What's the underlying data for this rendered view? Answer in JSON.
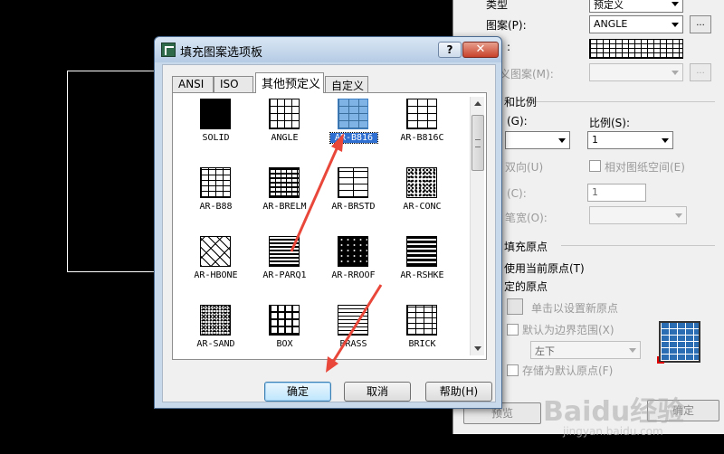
{
  "dialog": {
    "title": "填充图案选项板",
    "help_glyph": "?",
    "close_glyph": "✕",
    "tabs": [
      {
        "label": "ANSI"
      },
      {
        "label": "ISO"
      },
      {
        "label": "其他预定义"
      },
      {
        "label": "自定义"
      }
    ],
    "active_tab": "其他预定义",
    "patterns": [
      {
        "label": "SOLID"
      },
      {
        "label": "ANGLE"
      },
      {
        "label": "AR-B816"
      },
      {
        "label": "AR-B816C"
      },
      {
        "label": "AR-B88"
      },
      {
        "label": "AR-BRELM"
      },
      {
        "label": "AR-BRSTD"
      },
      {
        "label": "AR-CONC"
      },
      {
        "label": "AR-HBONE"
      },
      {
        "label": "AR-PARQ1"
      },
      {
        "label": "AR-RROOF"
      },
      {
        "label": "AR-RSHKE"
      },
      {
        "label": "AR-SAND"
      },
      {
        "label": "BOX"
      },
      {
        "label": "BRASS"
      },
      {
        "label": "BRICK"
      }
    ],
    "selected_pattern": "AR-B816",
    "buttons": {
      "ok": "确定",
      "cancel": "取消",
      "help": "帮助(H)"
    }
  },
  "background_dialog": {
    "type_label": "类型",
    "type_value": "预定义",
    "pattern_label": "图案(P):",
    "pattern_value": "ANGLE",
    "dots": "...",
    "sample_label": ":",
    "custom_pattern_label": "义图案(M):",
    "angle_scale_heading": "和比例",
    "angle_label": "(G):",
    "scale_label": "比例(S):",
    "scale_value": "1",
    "bidirectional_label": "双向(U)",
    "relative_paper_label": "相对图纸空间(E)",
    "spacing_label": "(C):",
    "spacing_value": "1",
    "iso_pen_label": "笔宽(O):",
    "origin_heading": "填充原点",
    "use_current_origin": "使用当前原点(T)",
    "specified_origin": "定的原点",
    "click_set_origin": "单击以设置新原点",
    "default_boundary": "默认为边界范围(X)",
    "boundary_value": "左下",
    "store_default": "存储为默认原点(F)",
    "preview_btn": "预览",
    "ok_btn": "确定"
  },
  "watermark": {
    "main": "Baidu经验",
    "sub": "jingyan.baidu.com"
  },
  "colors": {
    "selection": "#2f6fd1",
    "arrow": "#e8473a",
    "canvas": "#000000"
  }
}
